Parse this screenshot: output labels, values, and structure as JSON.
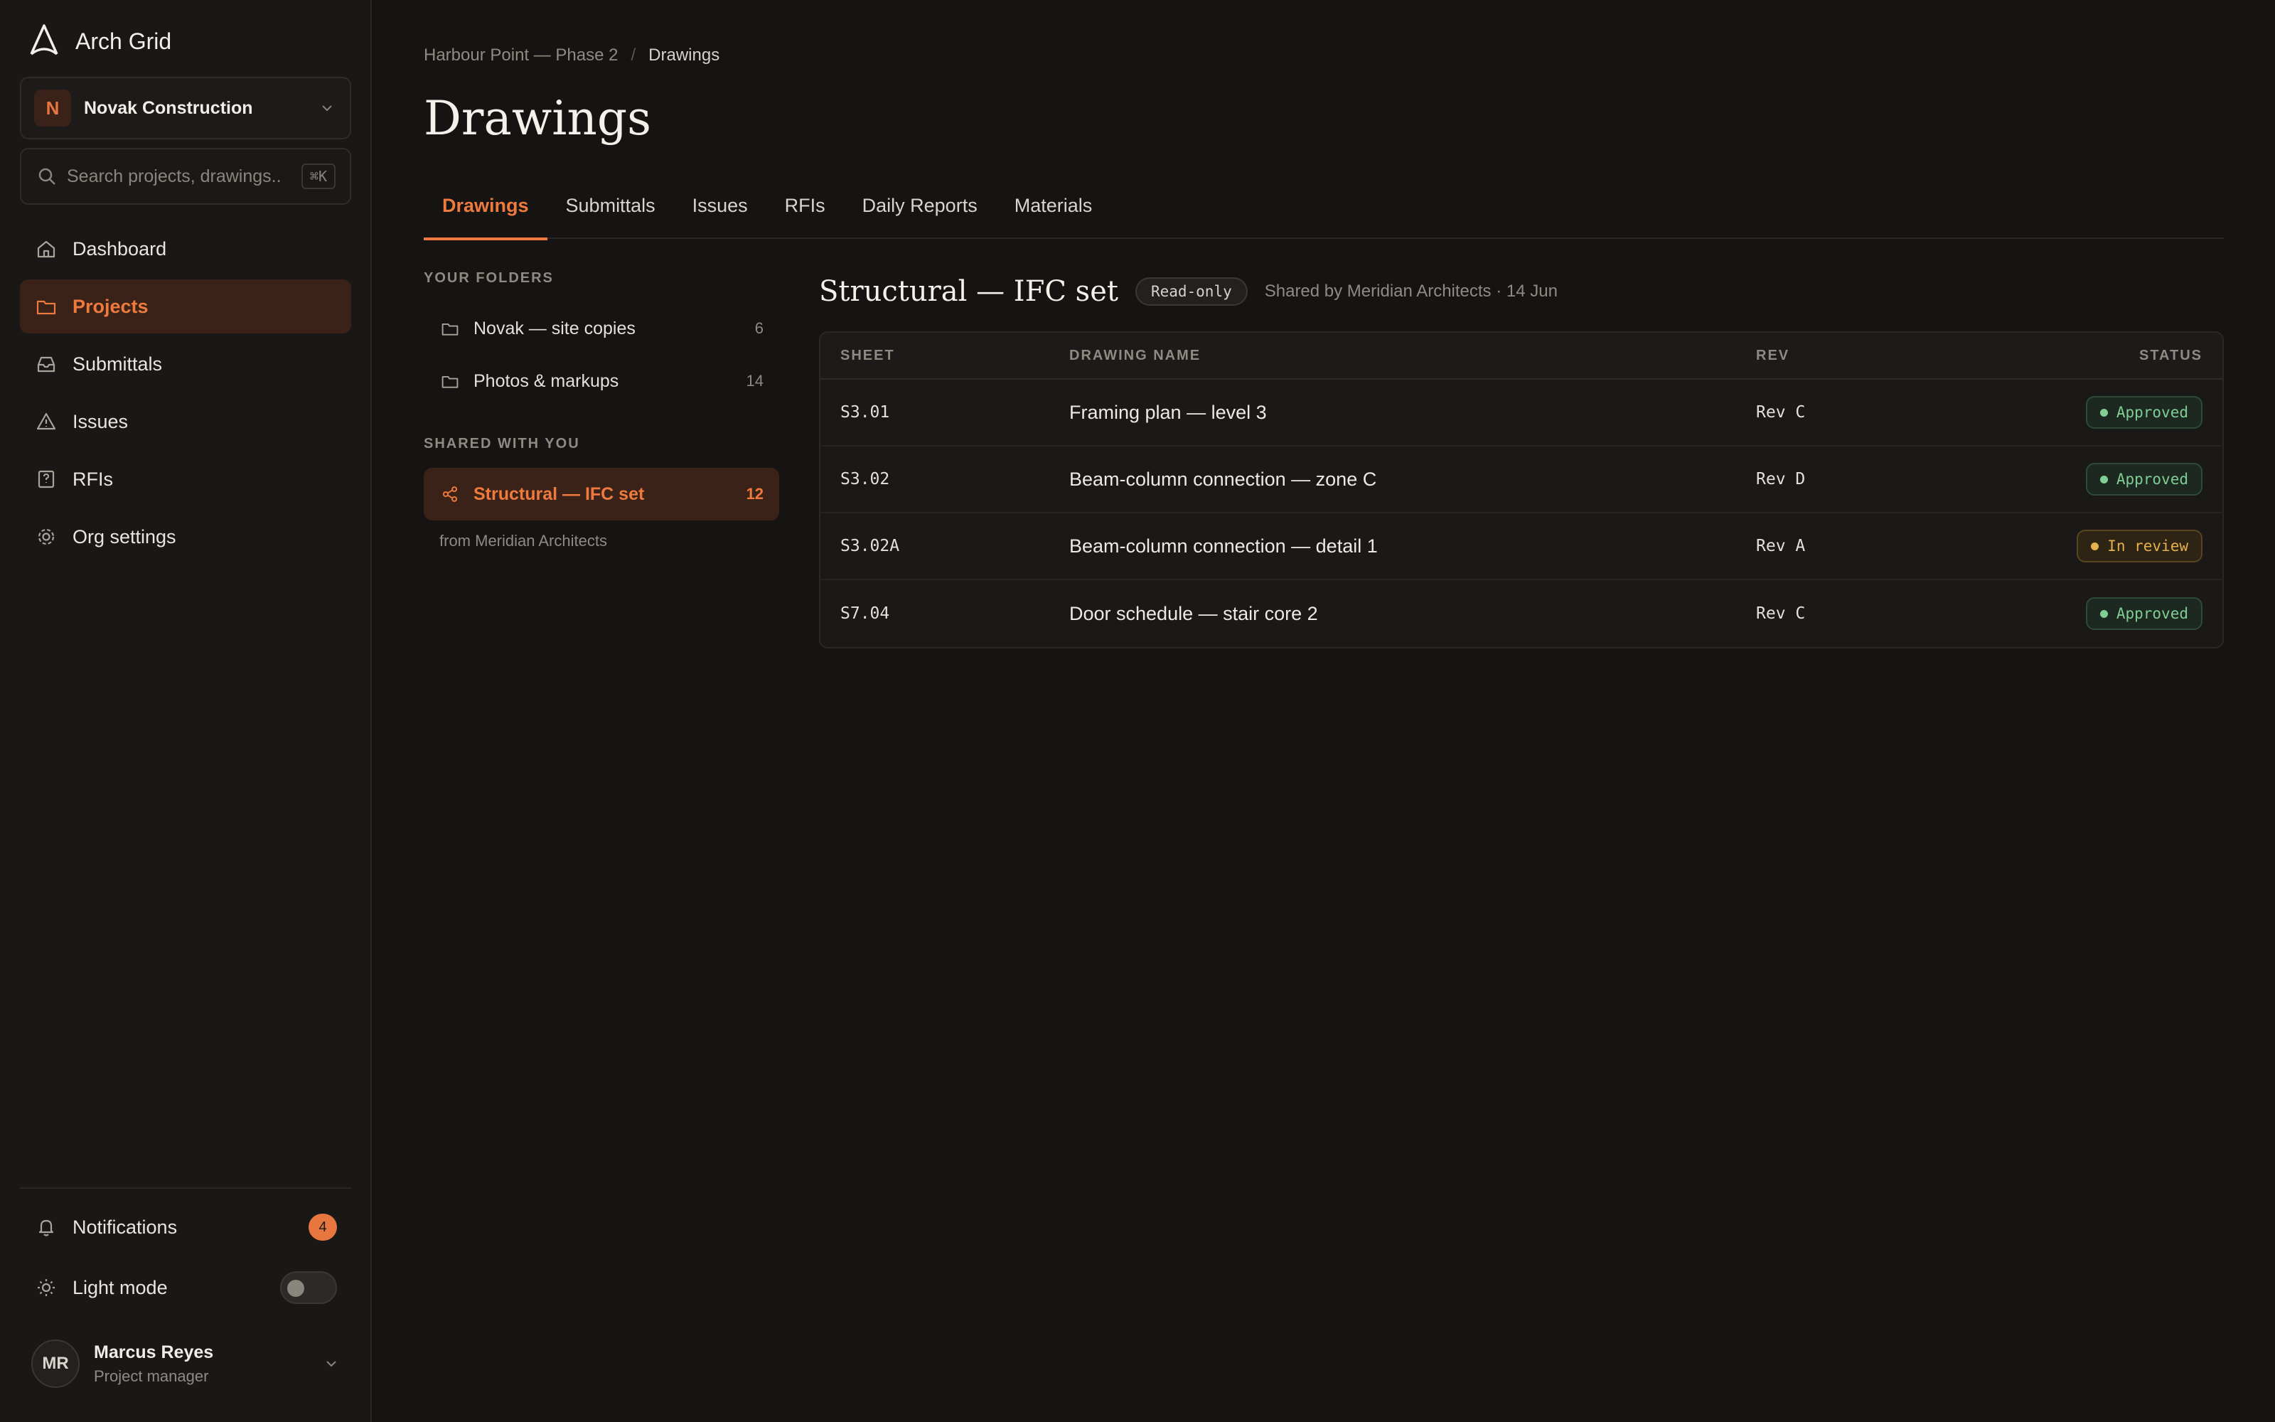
{
  "app": {
    "name": "Arch Grid",
    "accent": "#ee7a3e"
  },
  "org": {
    "initial": "N",
    "name": "Novak Construction"
  },
  "search": {
    "placeholder": "Search projects, drawings..",
    "shortcut": "⌘K"
  },
  "nav": [
    {
      "label": "Dashboard",
      "icon": "home-icon"
    },
    {
      "label": "Projects",
      "icon": "folder-icon",
      "active": true
    },
    {
      "label": "Submittals",
      "icon": "inbox-icon"
    },
    {
      "label": "Issues",
      "icon": "warning-icon"
    },
    {
      "label": "RFIs",
      "icon": "question-icon"
    },
    {
      "label": "Org settings",
      "icon": "gear-icon"
    }
  ],
  "bottom": {
    "notifications_label": "Notifications",
    "notifications_count": "4",
    "light_mode_label": "Light mode",
    "light_mode_on": false
  },
  "user": {
    "initials": "MR",
    "name": "Marcus Reyes",
    "role": "Project manager"
  },
  "breadcrumb": {
    "project": "Harbour Point — Phase 2",
    "separator": "/",
    "current": "Drawings"
  },
  "page_title": "Drawings",
  "tabs": [
    "Drawings",
    "Submittals",
    "Issues",
    "RFIs",
    "Daily Reports",
    "Materials"
  ],
  "folders": {
    "your_label": "YOUR FOLDERS",
    "your": [
      {
        "name": "Novak — site copies",
        "count": "6"
      },
      {
        "name": "Photos & markups",
        "count": "14"
      }
    ],
    "shared_label": "SHARED WITH YOU",
    "shared": [
      {
        "name": "Structural — IFC set",
        "count": "12"
      }
    ],
    "shared_note": "from Meridian Architects"
  },
  "content": {
    "title": "Structural — IFC set",
    "badge": "Read-only",
    "meta": "Shared by Meridian Architects · 14 Jun",
    "columns": [
      "SHEET",
      "DRAWING NAME",
      "REV",
      "STATUS"
    ],
    "rows": [
      {
        "sheet": "S3.01",
        "name": "Framing plan — level 3",
        "rev": "Rev C",
        "status": "Approved"
      },
      {
        "sheet": "S3.02",
        "name": "Beam-column connection — zone C",
        "rev": "Rev D",
        "status": "Approved"
      },
      {
        "sheet": "S3.02A",
        "name": "Beam-column connection — detail 1",
        "rev": "Rev A",
        "status": "In review"
      },
      {
        "sheet": "S7.04",
        "name": "Door schedule — stair core 2",
        "rev": "Rev C",
        "status": "Approved"
      }
    ]
  }
}
